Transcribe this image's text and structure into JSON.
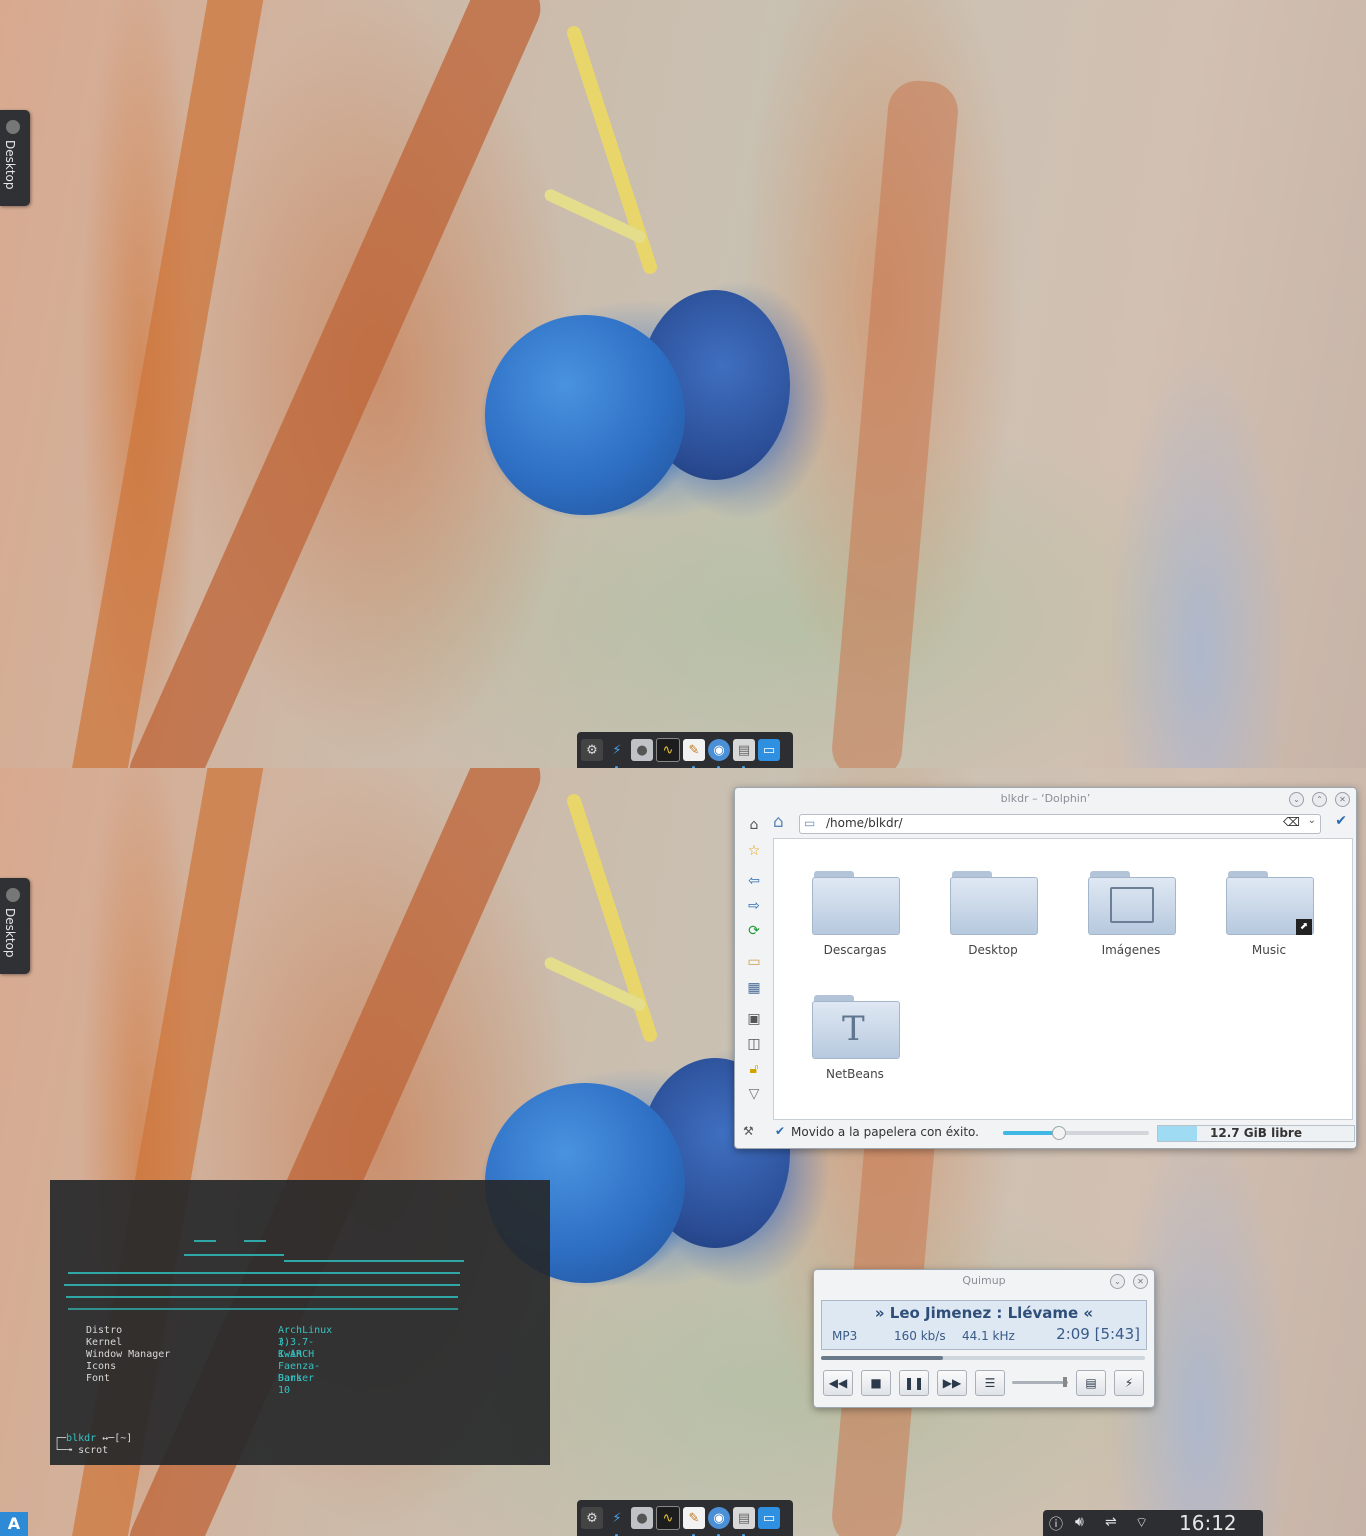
{
  "desktop_tab": {
    "label": "Desktop"
  },
  "dock": {
    "icons": [
      "settings-icon",
      "lightning-icon",
      "disc-icon",
      "system-monitor-icon",
      "text-editor-icon",
      "chromium-icon",
      "file-manager-icon",
      "desktop-icon"
    ]
  },
  "dolphin": {
    "title": "blkdr – ‘Dolphin’",
    "path": "/home/blkdr/",
    "folders": [
      {
        "name": "Descargas"
      },
      {
        "name": "Desktop"
      },
      {
        "name": "Imágenes"
      },
      {
        "name": "Music"
      },
      {
        "name": "NetBeans"
      }
    ],
    "status_message": "Movido a la papelera con éxito.",
    "zoom_level": 0.38,
    "free_space_fraction": 0.2,
    "free_space": "12.7 GiB libre"
  },
  "terminal": {
    "info": [
      {
        "key": "Distro",
        "value": "ArchLinux  ()"
      },
      {
        "key": "Kernel",
        "value": "3.3.7-1-ARCH"
      },
      {
        "key": "Window Manager",
        "value": "Kwin"
      },
      {
        "key": "Icons",
        "value": "Faenza-Darker"
      },
      {
        "key": "Font",
        "value": "Sans 10"
      }
    ],
    "prompt_user": "blkdr",
    "prompt_path": "[~]",
    "command": "scrot"
  },
  "quimup": {
    "title": "Quimup",
    "track": "» Leo Jimenez : Llévame «",
    "format": "MP3",
    "bitrate": "160 kb/s",
    "samplerate": "44.1 kHz",
    "time": "2:09 [5:43]",
    "progress": 0.376,
    "volume": 0.95
  },
  "tray": {
    "clock": "16:12"
  },
  "colors": {
    "accent": "#3fb8e5",
    "panel": "#2c2e31",
    "terminal_text": "#35c2c2"
  }
}
